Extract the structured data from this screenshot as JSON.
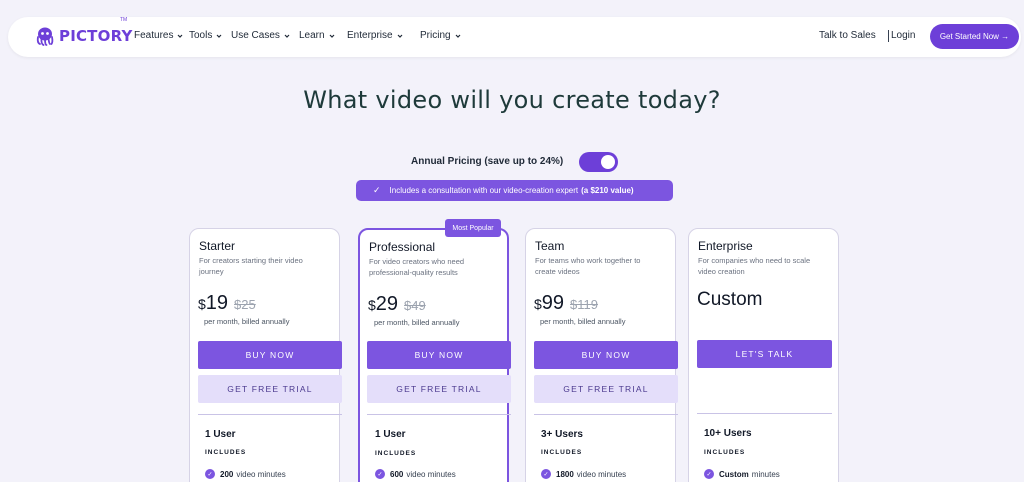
{
  "brand": {
    "name": "PICTORY",
    "tm": "TM",
    "color": "#6d3fd8"
  },
  "nav": {
    "items": [
      "Features",
      "Tools",
      "Use Cases",
      "Learn",
      "Enterprise",
      "Pricing"
    ],
    "talk_to_sales": "Talk to Sales",
    "login": "Login",
    "cta": "Get Started Now →"
  },
  "hero": {
    "title": "What video will you create today?",
    "toggle_label": "Annual Pricing (save up to 24%)",
    "toggle_on": true,
    "consultation_text": "Includes a consultation with our video-creation expert",
    "consultation_value": "(a $210 value)"
  },
  "badge": "Most Popular",
  "plans": [
    {
      "name": "Starter",
      "description": "For creators starting their video journey",
      "currency": "$",
      "price": "19",
      "old_price": "$25",
      "billing": "per month, billed annually",
      "buy_label": "BUY NOW",
      "trial_label": "GET FREE TRIAL",
      "users": "1 User",
      "includes": "INCLUDES",
      "feature_value": "200",
      "feature_text": "video minutes"
    },
    {
      "name": "Professional",
      "description": "For video creators who need professional-quality results",
      "currency": "$",
      "price": "29",
      "old_price": "$49",
      "billing": "per month, billed annually",
      "buy_label": "BUY NOW",
      "trial_label": "GET FREE TRIAL",
      "users": "1 User",
      "includes": "INCLUDES",
      "feature_value": "600",
      "feature_text": "video minutes"
    },
    {
      "name": "Team",
      "description": "For teams who work together to create videos",
      "currency": "$",
      "price": "99",
      "old_price": "$119",
      "billing": "per month, billed annually",
      "buy_label": "BUY NOW",
      "trial_label": "GET FREE TRIAL",
      "users": "3+ Users",
      "includes": "INCLUDES",
      "feature_value": "1800",
      "feature_text": "video minutes"
    },
    {
      "name": "Enterprise",
      "description": "For companies who need  to scale video creation",
      "price_custom": "Custom",
      "buy_label": "LET'S TALK",
      "users": "10+ Users",
      "includes": "INCLUDES",
      "feature_value": "Custom",
      "feature_text": "minutes"
    }
  ]
}
